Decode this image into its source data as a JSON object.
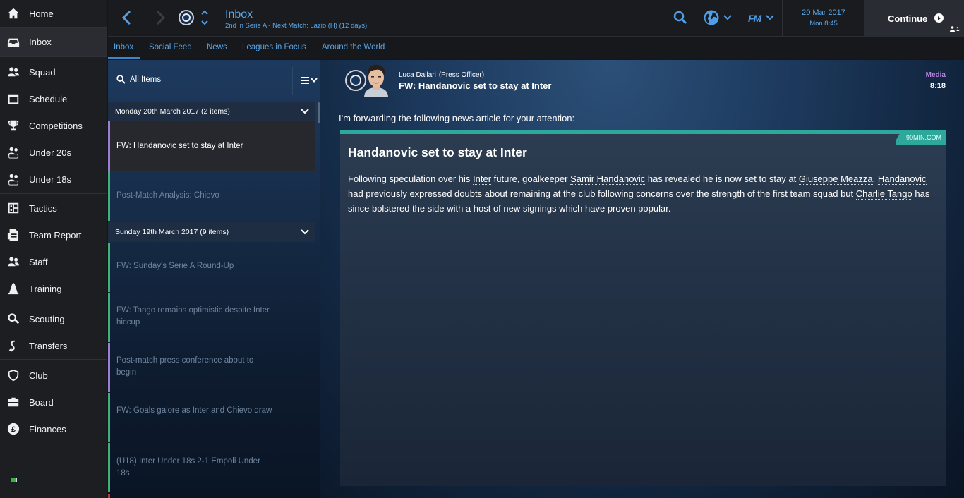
{
  "sidebar": {
    "items": [
      {
        "label": "Home",
        "icon": "home-icon"
      },
      {
        "label": "Inbox",
        "icon": "inbox-icon"
      },
      {
        "label": "Squad",
        "icon": "squad-icon"
      },
      {
        "label": "Schedule",
        "icon": "calendar-icon"
      },
      {
        "label": "Competitions",
        "icon": "trophy-icon"
      },
      {
        "label": "Under 20s",
        "icon": "under20-icon"
      },
      {
        "label": "Under 18s",
        "icon": "under18-icon"
      },
      {
        "label": "Tactics",
        "icon": "tactics-icon"
      },
      {
        "label": "Team Report",
        "icon": "report-icon"
      },
      {
        "label": "Staff",
        "icon": "staff-icon"
      },
      {
        "label": "Training",
        "icon": "training-icon"
      },
      {
        "label": "Scouting",
        "icon": "search-icon"
      },
      {
        "label": "Transfers",
        "icon": "transfers-icon"
      },
      {
        "label": "Club",
        "icon": "shield-icon"
      },
      {
        "label": "Board",
        "icon": "briefcase-icon"
      },
      {
        "label": "Finances",
        "icon": "pound-icon"
      }
    ],
    "active": "Inbox"
  },
  "topbar": {
    "title": "Inbox",
    "subtitle": "2nd in Serie A - Next Match: Lazio (H) (12 days)",
    "logo": "FM",
    "date": "20 Mar 2017",
    "time": "Mon 8:45",
    "continue_label": "Continue",
    "user_count": "1"
  },
  "tabs": [
    {
      "label": "Inbox",
      "active": true
    },
    {
      "label": "Social Feed"
    },
    {
      "label": "News"
    },
    {
      "label": "Leagues in Focus"
    },
    {
      "label": "Around the World"
    }
  ],
  "inbox": {
    "filter_label": "All Items",
    "groups": [
      {
        "header": "Monday 20th March 2017 (2 items)",
        "messages": [
          {
            "subject": "FW: Handanovic set to stay at Inter",
            "selected": true,
            "bar_color": "#9b7fd4"
          },
          {
            "subject": "Post-Match Analysis: Chievo",
            "bar_color": "#3fb17a"
          }
        ]
      },
      {
        "header": "Sunday 19th March 2017 (9 items)",
        "messages": [
          {
            "subject": "FW: Sunday's Serie A Round-Up",
            "bar_color": "#3fb17a"
          },
          {
            "subject": "FW: Tango remains optimistic despite Inter hiccup",
            "bar_color": "#3fb17a"
          },
          {
            "subject": "Post-match press conference about to begin",
            "bar_color": "#9b7fd4"
          },
          {
            "subject": "FW: Goals galore as Inter and Chievo draw",
            "bar_color": "#3fb17a"
          },
          {
            "subject": "(U18) Inter Under 18s 2-1 Empoli Under 18s",
            "bar_color": "#3fb17a"
          }
        ]
      }
    ]
  },
  "message": {
    "sender_name": "Luca Dallari",
    "sender_role": "(Press Officer)",
    "subject": "FW: Handanovic set to stay at Inter",
    "category": "Media",
    "time": "8:18",
    "intro": "I'm forwarding the following news article for your attention:",
    "article": {
      "source": "90MIN.COM",
      "headline": "Handanovic set to stay at Inter",
      "body_parts": [
        "Following speculation over his ",
        "Inter",
        " future, goalkeeper ",
        "Samir Handanovic",
        " has revealed he is now set to stay at ",
        "Giuseppe Meazza",
        ". ",
        "Handanovic",
        " had previously expressed doubts about remaining at the club following concerns over the strength of the first team squad but ",
        "Charlie Tango",
        " has since bolstered the side with a host of new signings which have proven popular."
      ]
    }
  },
  "colors": {
    "accent_blue": "#5aa7e9",
    "media_purple": "#b982e0",
    "article_teal": "#2ea89b",
    "unread_green": "#3fb17a",
    "unread_purple": "#9b7fd4"
  }
}
